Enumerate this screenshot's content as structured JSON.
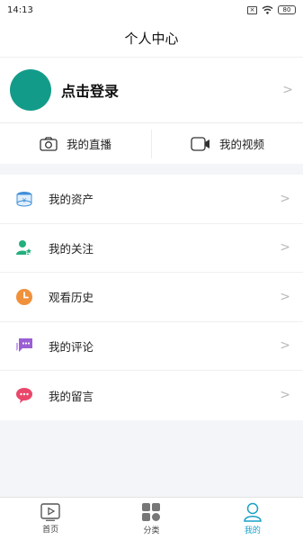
{
  "status": {
    "time": "14:13",
    "battery": "80"
  },
  "header": {
    "title": "个人中心"
  },
  "profile": {
    "login_text": "点击登录"
  },
  "quick": [
    {
      "label": "我的直播",
      "icon": "camera-icon"
    },
    {
      "label": "我的视频",
      "icon": "video-camera-icon"
    }
  ],
  "menu": [
    {
      "label": "我的资产",
      "icon": "wallet-stack-icon",
      "color": "#3f8fd8"
    },
    {
      "label": "我的关注",
      "icon": "user-star-icon",
      "color": "#22b07d"
    },
    {
      "label": "观看历史",
      "icon": "clock-icon",
      "color": "#f0913b"
    },
    {
      "label": "我的评论",
      "icon": "comment-icon",
      "color": "#9a5fd3"
    },
    {
      "label": "我的留言",
      "icon": "message-bubble-icon",
      "color": "#e9476a"
    }
  ],
  "tabs": [
    {
      "label": "首页",
      "icon": "play-box-icon",
      "active": false
    },
    {
      "label": "分类",
      "icon": "grid-icon",
      "active": false
    },
    {
      "label": "我的",
      "icon": "user-icon",
      "active": true,
      "color": "#1aa0c8"
    }
  ]
}
